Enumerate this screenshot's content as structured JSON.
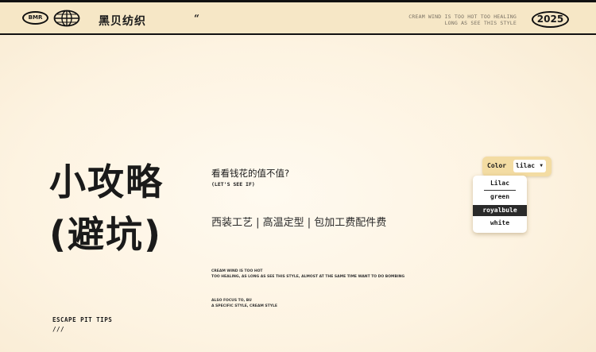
{
  "header": {
    "logo_text": "BMR",
    "globe_icon": "globe-icon",
    "brand_name": "黑贝纺织",
    "quote_mark": "“",
    "slogan_line1": "CREAM WIND IS TOO HOT TOO HEALING",
    "slogan_line2": "LONG AS SEE THIS STYLE",
    "year": "2025"
  },
  "hero": {
    "title_line1": "小攻略",
    "title_line2": "(避坑)",
    "footer_line1": "ESCAPE PIT TIPS",
    "footer_line2": "///"
  },
  "content": {
    "question": "看看钱花的值不值?",
    "question_sub": "(LET'S SEE IF)",
    "services": "西装工艺 | 高温定型 | 包加工费配件费",
    "fine_print_1a": "CREAM WIND IS TOO HOT",
    "fine_print_1b": "TOO HEALING, AS LONG AS SEE THIS STYLE, ALMOST AT THE SAME TIME WANT TO DO BOMBING",
    "fine_print_2a": "ALSO FOCUS TO, BU",
    "fine_print_2b": "A SPECIFIC STYLE, CREAM STYLE"
  },
  "color_picker": {
    "label": "Color",
    "selected_value": "lilac",
    "caret_icon": "chevron-down-icon",
    "options": [
      "Lilac",
      "green",
      "royalbule",
      "white"
    ],
    "highlighted_option": "royalbule"
  }
}
